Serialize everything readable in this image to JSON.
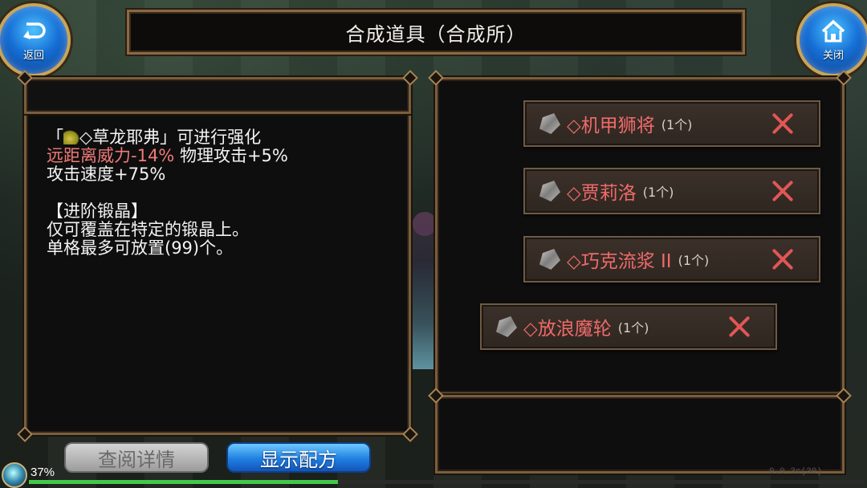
{
  "header": {
    "title": "合成道具（合成所）",
    "back_label": "返回",
    "close_label": "关闭"
  },
  "description": {
    "line1_prefix": "「",
    "line1_item": "◇草龙耶弗」可进行强化",
    "line2_red": "远距离威力-14%",
    "line2_rest": " 物理攻击+5%",
    "line3": "攻击速度+75%",
    "line4": "【进阶锻晶】",
    "line5": "仅可覆盖在特定的锻晶上。",
    "line6": "单格最多可放置(99)个。"
  },
  "items": [
    {
      "name": "◇机甲狮将",
      "count": "(1个)"
    },
    {
      "name": "◇贾莉洛",
      "count": "(1个)"
    },
    {
      "name": "◇巧克流浆 II",
      "count": "(1个)"
    },
    {
      "name": "◇放浪魔轮",
      "count": "(1个)"
    }
  ],
  "buttons": {
    "details": "查阅详情",
    "show_recipe": "显示配方"
  },
  "status": {
    "percent": "37%",
    "progress": 0.37,
    "version": "0.0.3c(30)"
  },
  "colors": {
    "accent_blue": "#1f7fe0",
    "frame_gold": "#7a5e3c",
    "item_red": "#f06a6a",
    "progress_green": "#43c84a"
  },
  "icons": {
    "back": "return-arrow-icon",
    "close": "home-icon",
    "item": "crystal-shard-icon",
    "remove": "close-x-icon"
  }
}
